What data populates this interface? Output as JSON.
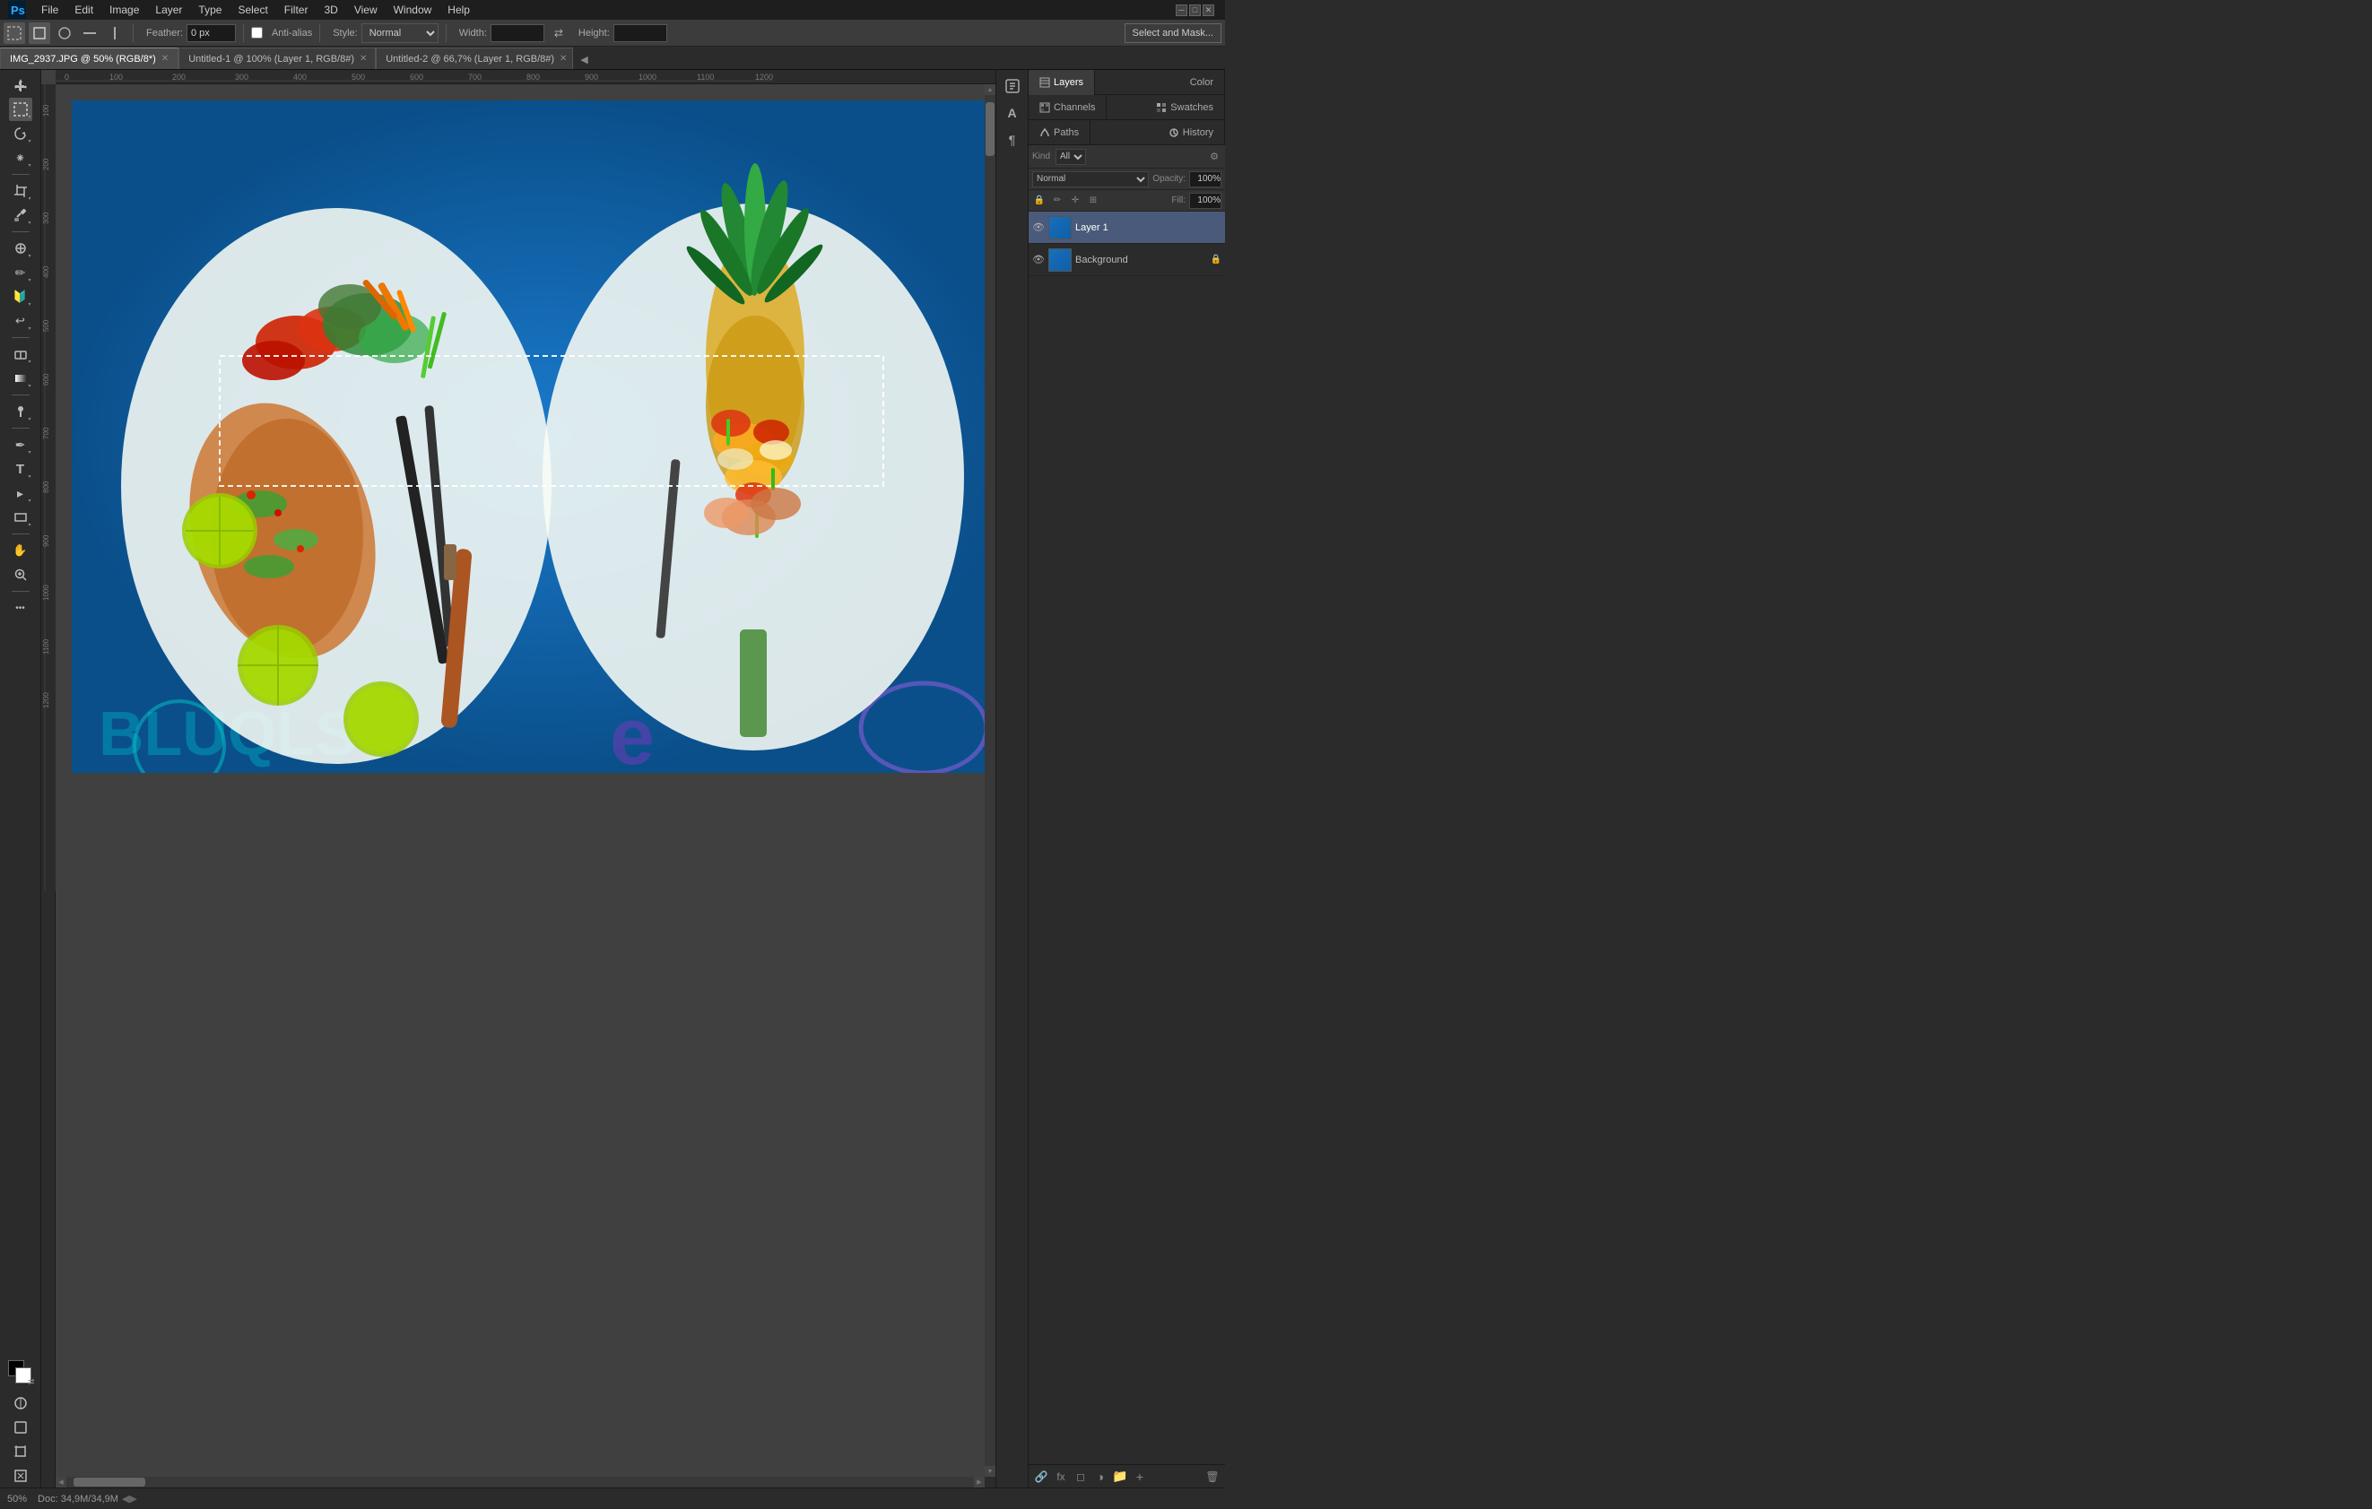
{
  "app": {
    "title": "Adobe Photoshop"
  },
  "menu": {
    "items": [
      "PS",
      "File",
      "Edit",
      "Image",
      "Layer",
      "Type",
      "Select",
      "Filter",
      "3D",
      "View",
      "Window",
      "Help"
    ]
  },
  "toolbar": {
    "feather_label": "Feather:",
    "feather_value": "0 px",
    "anti_alias_label": "Anti-alias",
    "style_label": "Style:",
    "style_value": "Normal",
    "width_label": "Width:",
    "height_label": "Height:",
    "select_mask_btn": "Select and Mask..."
  },
  "tabs": [
    {
      "label": "IMG_2937.JPG @ 50% (RGB/8*)",
      "active": true
    },
    {
      "label": "Untitled-1 @ 100% (Layer 1, RGB/8#)",
      "active": false
    },
    {
      "label": "Untitled-2 @ 66,7% (Layer 1, RGB/8#)",
      "active": false
    }
  ],
  "tools": {
    "items": [
      {
        "name": "move",
        "icon": "✛",
        "tooltip": "Move Tool"
      },
      {
        "name": "marquee",
        "icon": "⬚",
        "tooltip": "Marquee Tool",
        "active": true
      },
      {
        "name": "lasso",
        "icon": "⌾",
        "tooltip": "Lasso Tool"
      },
      {
        "name": "magic-wand",
        "icon": "⁕",
        "tooltip": "Magic Wand"
      },
      {
        "name": "crop",
        "icon": "⌗",
        "tooltip": "Crop Tool"
      },
      {
        "name": "eyedropper",
        "icon": "🔬",
        "tooltip": "Eyedropper"
      },
      {
        "name": "healing",
        "icon": "⊕",
        "tooltip": "Healing Brush"
      },
      {
        "name": "brush",
        "icon": "✏",
        "tooltip": "Brush Tool"
      },
      {
        "name": "clone-stamp",
        "icon": "✦",
        "tooltip": "Clone Stamp"
      },
      {
        "name": "history-brush",
        "icon": "↩",
        "tooltip": "History Brush"
      },
      {
        "name": "eraser",
        "icon": "◻",
        "tooltip": "Eraser"
      },
      {
        "name": "gradient",
        "icon": "▦",
        "tooltip": "Gradient Tool"
      },
      {
        "name": "dodge",
        "icon": "◑",
        "tooltip": "Dodge Tool"
      },
      {
        "name": "pen",
        "icon": "✒",
        "tooltip": "Pen Tool"
      },
      {
        "name": "type",
        "icon": "T",
        "tooltip": "Type Tool"
      },
      {
        "name": "path-selection",
        "icon": "▸",
        "tooltip": "Path Selection"
      },
      {
        "name": "rectangle",
        "icon": "▭",
        "tooltip": "Rectangle Tool"
      },
      {
        "name": "hand",
        "icon": "✋",
        "tooltip": "Hand Tool"
      },
      {
        "name": "zoom",
        "icon": "🔍",
        "tooltip": "Zoom Tool"
      },
      {
        "name": "more",
        "icon": "•••",
        "tooltip": "More Tools"
      }
    ]
  },
  "right_panel": {
    "top_tabs": [
      {
        "label": "Layers",
        "active": true,
        "icon": "☰"
      },
      {
        "label": "Color",
        "active": false,
        "icon": "◉"
      },
      {
        "label": "Channels",
        "active": false,
        "icon": "▦"
      },
      {
        "label": "Swatches",
        "active": false,
        "icon": "⊞"
      },
      {
        "label": "Paths",
        "active": false,
        "icon": "⌒"
      },
      {
        "label": "History",
        "active": false,
        "icon": "↺"
      }
    ]
  },
  "status_bar": {
    "zoom": "50%",
    "doc_info": "Doc: 34,9M/34,9M"
  },
  "colors": {
    "bg": "#2b2b2b",
    "menubar": "#1e1e1e",
    "toolbar": "#3c3c3c",
    "panel": "#2b2b2b",
    "canvas_bg": "#404040",
    "accent": "#4a90d9"
  }
}
